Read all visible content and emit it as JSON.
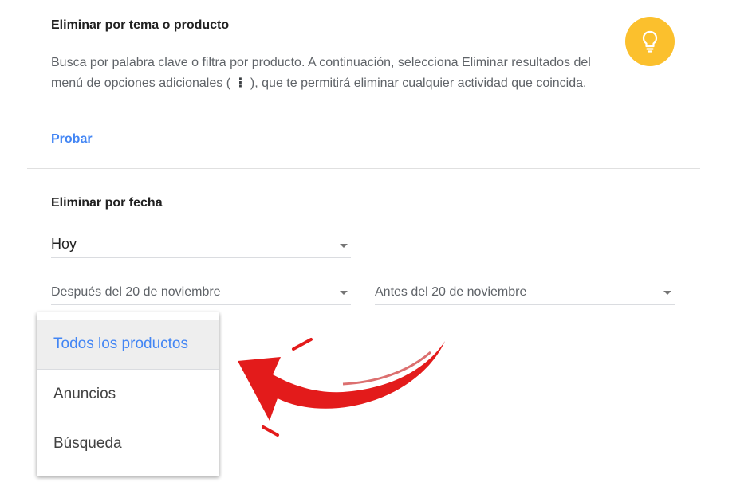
{
  "topic_section": {
    "title": "Eliminar por tema o producto",
    "description_part1": "Busca por palabra clave o filtra por producto. A continuación, selecciona Eliminar resultados del menú de opciones adicionales ( ",
    "kebab_glyph": "⋮",
    "description_part2": " ), que te permitirá eliminar cualquier actividad que coincida.",
    "try_link": "Probar",
    "icon": "lightbulb-icon",
    "icon_color": "#fbc02d"
  },
  "date_section": {
    "title": "Eliminar por fecha",
    "range_value": "Hoy",
    "after_value": "Después del 20 de noviembre",
    "before_value": "Antes del 20 de noviembre"
  },
  "product_menu": {
    "items": [
      {
        "label": "Todos los productos",
        "selected": true
      },
      {
        "label": "Anuncios",
        "selected": false
      },
      {
        "label": "Búsqueda",
        "selected": false
      }
    ]
  },
  "annotation": {
    "type": "red-arrow",
    "color": "#e31b1b"
  },
  "colors": {
    "accent": "#4285f4",
    "text_secondary": "#5f6368"
  }
}
